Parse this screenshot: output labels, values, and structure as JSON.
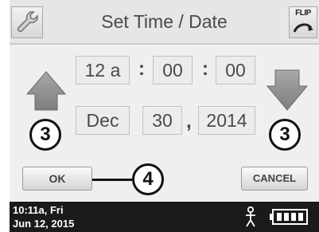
{
  "title": "Set Time / Date",
  "flip_label": "FLIP",
  "time": {
    "hour": "12 a",
    "minute": "00",
    "second": "00",
    "sep1": ":",
    "sep2": ":"
  },
  "date": {
    "month": "Dec",
    "day": "30",
    "year": "2014",
    "sep": ","
  },
  "callouts": {
    "left_number": "3",
    "right_number": "3",
    "ok_number": "4"
  },
  "buttons": {
    "ok": "OK",
    "cancel": "CANCEL"
  },
  "status": {
    "time": "10:11a, Fri",
    "date": "Jun 12, 2015",
    "battery_level": 1.0
  },
  "icons": {
    "top_left": "wrench-icon",
    "top_right": "flip-screen-icon",
    "left_arrow": "up-arrow-icon",
    "right_arrow": "down-arrow-icon",
    "status_person": "person-icon",
    "status_battery": "battery-icon"
  },
  "colors": {
    "background": "#efefef",
    "status_bar": "#1a1a1a",
    "arrow_fill": "#8c8c8c",
    "text": "#4a4a4a"
  }
}
